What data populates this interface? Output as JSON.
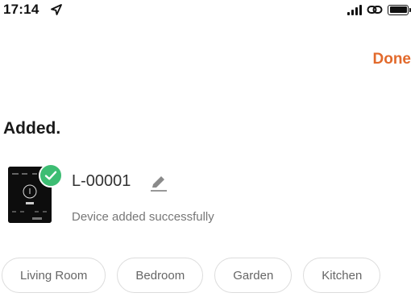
{
  "status_bar": {
    "time": "17:14"
  },
  "header": {
    "done_label": "Done",
    "accent_color": "#e26a2c"
  },
  "page": {
    "title": "Added."
  },
  "device": {
    "name": "L-00001",
    "status": "Device added successfully",
    "badge_color": "#3dbd73"
  },
  "rooms": [
    {
      "label": "Living Room"
    },
    {
      "label": "Bedroom"
    },
    {
      "label": "Garden"
    },
    {
      "label": "Kitchen"
    }
  ]
}
